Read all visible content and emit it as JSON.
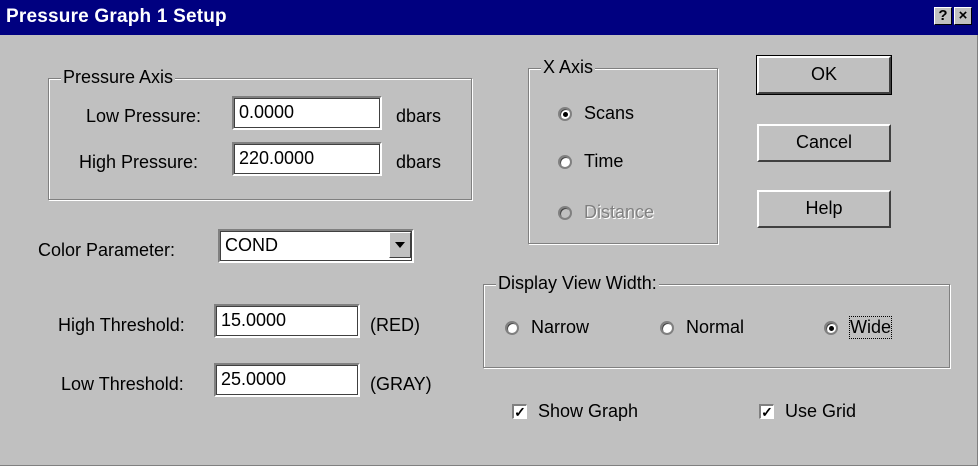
{
  "window": {
    "title": "Pressure Graph 1 Setup",
    "help_glyph": "?",
    "close_glyph": "×"
  },
  "pressure_axis": {
    "legend": "Pressure Axis",
    "low_label": "Low Pressure:",
    "low_value": "0.0000",
    "high_label": "High Pressure:",
    "high_value": "220.0000",
    "unit": "dbars"
  },
  "color_parameter": {
    "label": "Color Parameter:",
    "value": "COND"
  },
  "thresholds": {
    "high_label": "High Threshold:",
    "high_value": "15.0000",
    "high_note": "(RED)",
    "low_label": "Low Threshold:",
    "low_value": "25.0000",
    "low_note": "(GRAY)"
  },
  "x_axis": {
    "legend": "X Axis",
    "options": [
      {
        "label": "Scans",
        "selected": true,
        "enabled": true
      },
      {
        "label": "Time",
        "selected": false,
        "enabled": true
      },
      {
        "label": "Distance",
        "selected": false,
        "enabled": false
      }
    ]
  },
  "buttons": {
    "ok": "OK",
    "cancel": "Cancel",
    "help": "Help"
  },
  "display_view_width": {
    "legend": "Display View Width:",
    "options": [
      {
        "label": "Narrow",
        "selected": false
      },
      {
        "label": "Normal",
        "selected": false
      },
      {
        "label": "Wide",
        "selected": true
      }
    ]
  },
  "checkboxes": {
    "show_graph": {
      "label": "Show Graph",
      "checked": true
    },
    "use_grid": {
      "label": "Use Grid",
      "checked": true
    }
  },
  "colors": {
    "title_bar": "#000080",
    "face": "#c0c0c0"
  }
}
